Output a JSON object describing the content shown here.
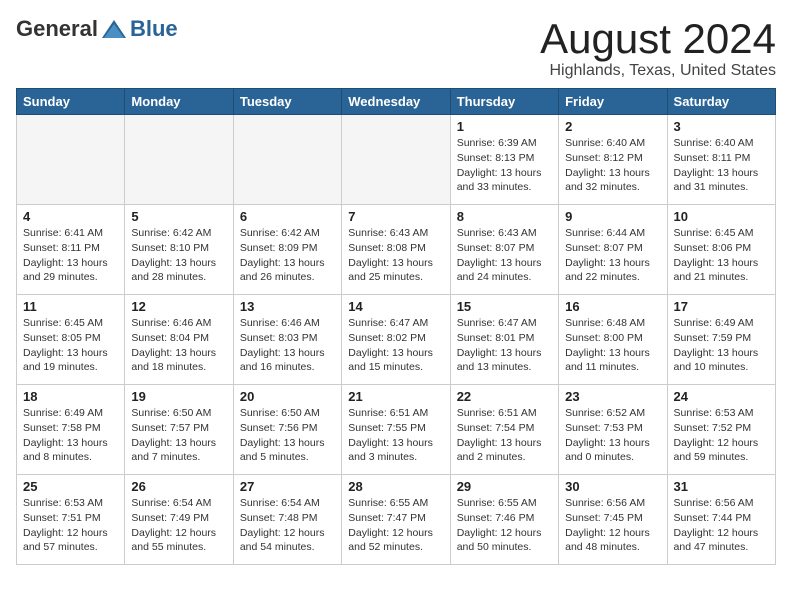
{
  "logo": {
    "general": "General",
    "blue": "Blue"
  },
  "header": {
    "month": "August 2024",
    "location": "Highlands, Texas, United States"
  },
  "weekdays": [
    "Sunday",
    "Monday",
    "Tuesday",
    "Wednesday",
    "Thursday",
    "Friday",
    "Saturday"
  ],
  "weeks": [
    [
      {
        "day": "",
        "info": ""
      },
      {
        "day": "",
        "info": ""
      },
      {
        "day": "",
        "info": ""
      },
      {
        "day": "",
        "info": ""
      },
      {
        "day": "1",
        "info": "Sunrise: 6:39 AM\nSunset: 8:13 PM\nDaylight: 13 hours\nand 33 minutes."
      },
      {
        "day": "2",
        "info": "Sunrise: 6:40 AM\nSunset: 8:12 PM\nDaylight: 13 hours\nand 32 minutes."
      },
      {
        "day": "3",
        "info": "Sunrise: 6:40 AM\nSunset: 8:11 PM\nDaylight: 13 hours\nand 31 minutes."
      }
    ],
    [
      {
        "day": "4",
        "info": "Sunrise: 6:41 AM\nSunset: 8:11 PM\nDaylight: 13 hours\nand 29 minutes."
      },
      {
        "day": "5",
        "info": "Sunrise: 6:42 AM\nSunset: 8:10 PM\nDaylight: 13 hours\nand 28 minutes."
      },
      {
        "day": "6",
        "info": "Sunrise: 6:42 AM\nSunset: 8:09 PM\nDaylight: 13 hours\nand 26 minutes."
      },
      {
        "day": "7",
        "info": "Sunrise: 6:43 AM\nSunset: 8:08 PM\nDaylight: 13 hours\nand 25 minutes."
      },
      {
        "day": "8",
        "info": "Sunrise: 6:43 AM\nSunset: 8:07 PM\nDaylight: 13 hours\nand 24 minutes."
      },
      {
        "day": "9",
        "info": "Sunrise: 6:44 AM\nSunset: 8:07 PM\nDaylight: 13 hours\nand 22 minutes."
      },
      {
        "day": "10",
        "info": "Sunrise: 6:45 AM\nSunset: 8:06 PM\nDaylight: 13 hours\nand 21 minutes."
      }
    ],
    [
      {
        "day": "11",
        "info": "Sunrise: 6:45 AM\nSunset: 8:05 PM\nDaylight: 13 hours\nand 19 minutes."
      },
      {
        "day": "12",
        "info": "Sunrise: 6:46 AM\nSunset: 8:04 PM\nDaylight: 13 hours\nand 18 minutes."
      },
      {
        "day": "13",
        "info": "Sunrise: 6:46 AM\nSunset: 8:03 PM\nDaylight: 13 hours\nand 16 minutes."
      },
      {
        "day": "14",
        "info": "Sunrise: 6:47 AM\nSunset: 8:02 PM\nDaylight: 13 hours\nand 15 minutes."
      },
      {
        "day": "15",
        "info": "Sunrise: 6:47 AM\nSunset: 8:01 PM\nDaylight: 13 hours\nand 13 minutes."
      },
      {
        "day": "16",
        "info": "Sunrise: 6:48 AM\nSunset: 8:00 PM\nDaylight: 13 hours\nand 11 minutes."
      },
      {
        "day": "17",
        "info": "Sunrise: 6:49 AM\nSunset: 7:59 PM\nDaylight: 13 hours\nand 10 minutes."
      }
    ],
    [
      {
        "day": "18",
        "info": "Sunrise: 6:49 AM\nSunset: 7:58 PM\nDaylight: 13 hours\nand 8 minutes."
      },
      {
        "day": "19",
        "info": "Sunrise: 6:50 AM\nSunset: 7:57 PM\nDaylight: 13 hours\nand 7 minutes."
      },
      {
        "day": "20",
        "info": "Sunrise: 6:50 AM\nSunset: 7:56 PM\nDaylight: 13 hours\nand 5 minutes."
      },
      {
        "day": "21",
        "info": "Sunrise: 6:51 AM\nSunset: 7:55 PM\nDaylight: 13 hours\nand 3 minutes."
      },
      {
        "day": "22",
        "info": "Sunrise: 6:51 AM\nSunset: 7:54 PM\nDaylight: 13 hours\nand 2 minutes."
      },
      {
        "day": "23",
        "info": "Sunrise: 6:52 AM\nSunset: 7:53 PM\nDaylight: 13 hours\nand 0 minutes."
      },
      {
        "day": "24",
        "info": "Sunrise: 6:53 AM\nSunset: 7:52 PM\nDaylight: 12 hours\nand 59 minutes."
      }
    ],
    [
      {
        "day": "25",
        "info": "Sunrise: 6:53 AM\nSunset: 7:51 PM\nDaylight: 12 hours\nand 57 minutes."
      },
      {
        "day": "26",
        "info": "Sunrise: 6:54 AM\nSunset: 7:49 PM\nDaylight: 12 hours\nand 55 minutes."
      },
      {
        "day": "27",
        "info": "Sunrise: 6:54 AM\nSunset: 7:48 PM\nDaylight: 12 hours\nand 54 minutes."
      },
      {
        "day": "28",
        "info": "Sunrise: 6:55 AM\nSunset: 7:47 PM\nDaylight: 12 hours\nand 52 minutes."
      },
      {
        "day": "29",
        "info": "Sunrise: 6:55 AM\nSunset: 7:46 PM\nDaylight: 12 hours\nand 50 minutes."
      },
      {
        "day": "30",
        "info": "Sunrise: 6:56 AM\nSunset: 7:45 PM\nDaylight: 12 hours\nand 48 minutes."
      },
      {
        "day": "31",
        "info": "Sunrise: 6:56 AM\nSunset: 7:44 PM\nDaylight: 12 hours\nand 47 minutes."
      }
    ]
  ]
}
